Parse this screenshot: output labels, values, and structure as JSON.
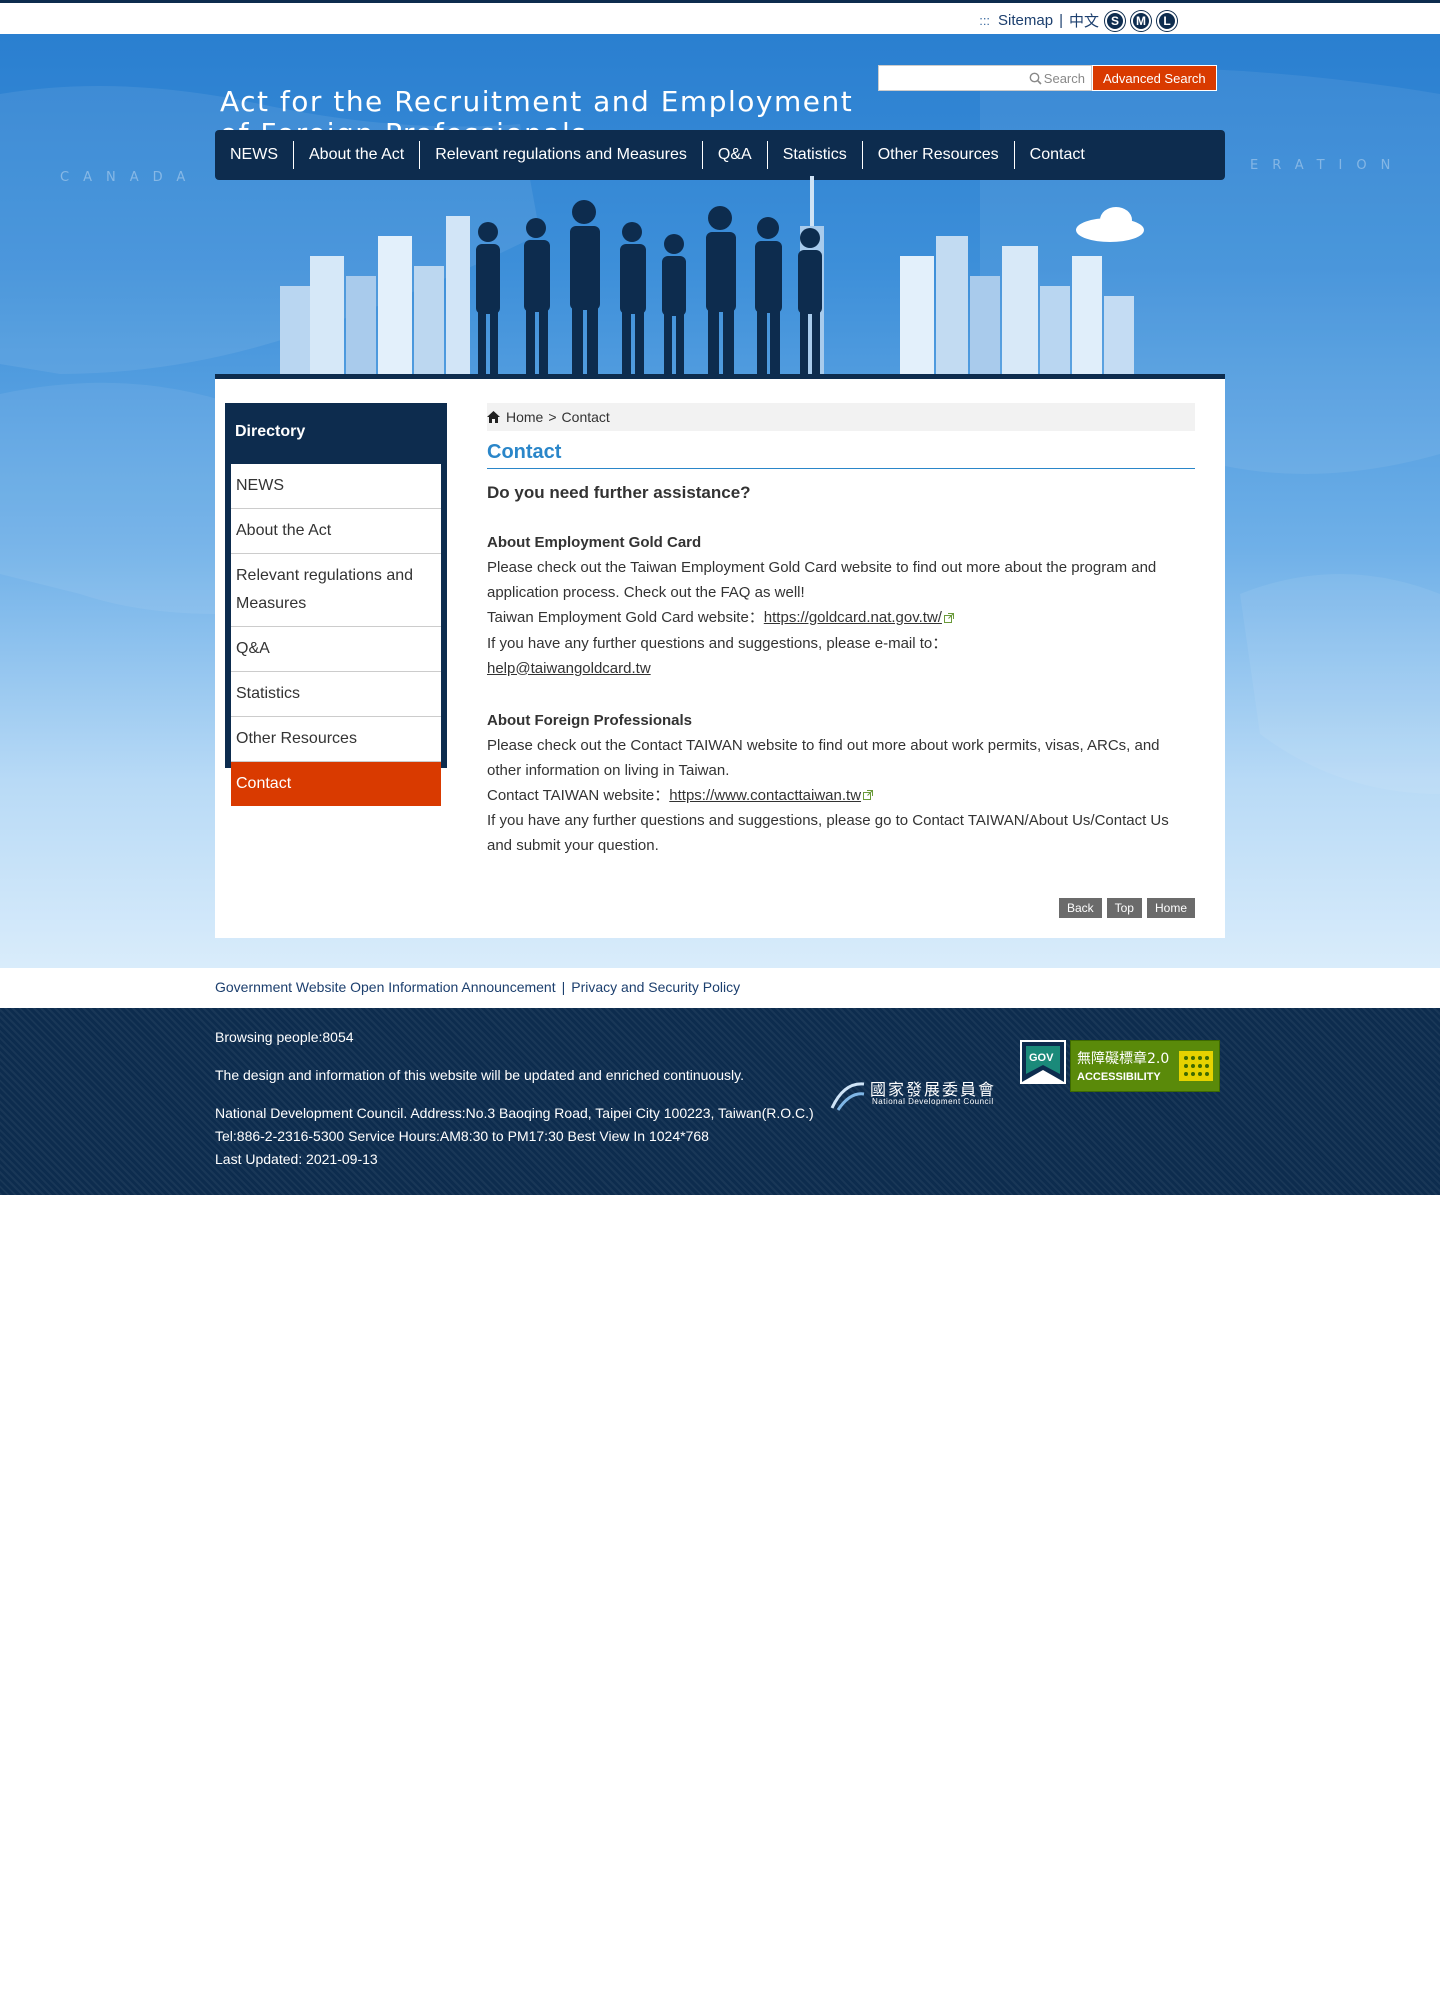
{
  "topbar": {
    "dots": ":::",
    "sitemap": "Sitemap",
    "chinese": "中文",
    "sizes": [
      "S",
      "M",
      "L"
    ]
  },
  "header": {
    "title_line1": "Act for the Recruitment and Employment",
    "title_line2": "of Foreign Professionals",
    "search_placeholder": "Search",
    "advanced_search": "Advanced Search"
  },
  "nav": {
    "items": [
      "NEWS",
      "About the Act",
      "Relevant regulations and Measures",
      "Q&A",
      "Statistics",
      "Other Resources",
      "Contact"
    ]
  },
  "sidebar": {
    "title": "Directory",
    "items": [
      {
        "label": "NEWS",
        "active": false
      },
      {
        "label": "About the Act",
        "active": false
      },
      {
        "label": "Relevant regulations and Measures",
        "active": false
      },
      {
        "label": "Q&A",
        "active": false
      },
      {
        "label": "Statistics",
        "active": false
      },
      {
        "label": "Other Resources",
        "active": false
      },
      {
        "label": "Contact",
        "active": true
      }
    ]
  },
  "breadcrumb": {
    "home": "Home",
    "separator": ">",
    "current": "Contact"
  },
  "main": {
    "page_title": "Contact",
    "lead": "Do you need further assistance?",
    "gold_card": {
      "heading": "About Employment Gold Card",
      "para": "Please check out the Taiwan Employment Gold Card website to find out more about the program and application process. Check out the FAQ as well!",
      "site_label": "Taiwan Employment Gold Card website：",
      "site_link": "https://goldcard.nat.gov.tw/",
      "email_label": "If you have any further questions and suggestions, please e-mail to：",
      "email_link": "help@taiwangoldcard.tw"
    },
    "foreign": {
      "heading": "About Foreign Professionals",
      "para": "Please check out the Contact TAIWAN website to find out more about work permits, visas, ARCs, and other information on living in Taiwan.",
      "site_label": "Contact TAIWAN website：",
      "site_link": "https://www.contacttaiwan.tw",
      "note": "If you have any further questions and suggestions, please go to Contact TAIWAN/About Us/Contact Us and submit your question."
    },
    "buttons": {
      "back": "Back",
      "top": "Top",
      "home": "Home"
    }
  },
  "footer_links": {
    "announcement": "Government Website Open Information Announcement",
    "separator": "|",
    "privacy": "Privacy and Security Policy"
  },
  "footer": {
    "browsing": "Browsing people:8054",
    "design_note": "The design and information of this website will be updated and enriched continuously.",
    "address": "National Development Council. Address:No.3 Baoqing Road, Taipei City 100223, Taiwan(R.O.C.)",
    "tel": "Tel:886-2-2316-5300 Service Hours:AM8:30 to PM17:30 Best View In 1024*768",
    "updated": "Last Updated: 2021-09-13",
    "ndc_cn": "國家發展委員會",
    "ndc_en": "National Development Council",
    "gov_badge": "GOV",
    "acc_badge_cn": "無障礙標章2.0",
    "acc_badge_en": "ACCESSIBILITY"
  },
  "colors": {
    "navy": "#0d2c4e",
    "accent_orange": "#d93a00",
    "title_blue": "#2a86c9",
    "link_blue": "#1c3f6e"
  }
}
